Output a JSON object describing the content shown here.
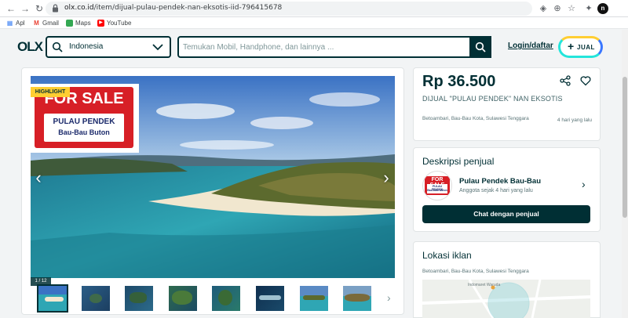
{
  "browser": {
    "url_host": "olx.co.id",
    "url_path": "/item/dijual-pulau-pendek-nan-eksotis-iid-796415678",
    "profile_initial": "n",
    "bookmarks": [
      {
        "label": "Apl",
        "icon": "apps-grid-icon"
      },
      {
        "label": "Gmail",
        "icon": "gmail-icon"
      },
      {
        "label": "Maps",
        "icon": "maps-icon"
      },
      {
        "label": "YouTube",
        "icon": "youtube-icon"
      }
    ]
  },
  "header": {
    "logo": "OLX",
    "location_value": "Indonesia",
    "search_placeholder": "Temukan Mobil, Handphone, dan lainnya ...",
    "login_label": "Login/daftar",
    "sell_label": "JUAL",
    "sell_plus": "+"
  },
  "gallery": {
    "highlight_badge": "HIGHLIGHT",
    "counter": "1 / 12",
    "sign_line1": "FOR SALE",
    "sign_line2": "PULAU PENDEK",
    "sign_line3": "Bau-Bau Buton",
    "prev_arrow": "‹",
    "next_arrow": "›",
    "thumb_next": "›"
  },
  "listing": {
    "price": "Rp 36.500",
    "title": "DIJUAL \"PULAU PENDEK\" NAN EKSOTIS",
    "location": "Betoambari, Bau-Bau Kota, Sulawesi Tenggara",
    "posted": "4 hari yang lalu"
  },
  "seller": {
    "heading": "Deskripsi penjual",
    "name": "Pulau Pendek Bau-Bau",
    "since": "Anggota sejak 4 hari yang lalu",
    "chat_label": "Chat dengan penjual",
    "avatar_line1": "FOR SALE",
    "avatar_line2": "PULAU PENDEK",
    "avatar_line3": "Bau-Bau Buton",
    "chevron": "›"
  },
  "location_card": {
    "heading": "Lokasi iklan",
    "address": "Betoambari, Bau-Bau Kota, Sulawesi Tenggara",
    "map_label": "Indomaret Waruda"
  },
  "colors": {
    "brand_dark": "#002f34",
    "highlight": "#ffce32",
    "sign_red": "#d71f26"
  }
}
